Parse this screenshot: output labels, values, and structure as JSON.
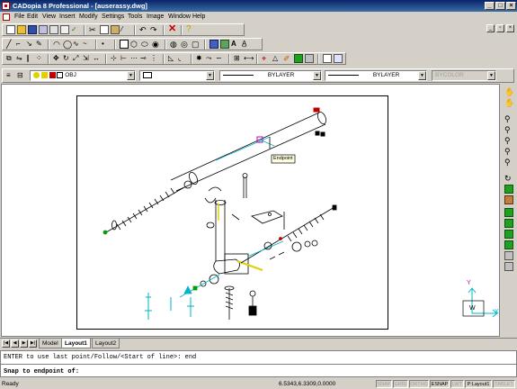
{
  "window": {
    "title": "CADopia 8 Professional - [auserassy.dwg]"
  },
  "menu": [
    "File",
    "Edit",
    "View",
    "Insert",
    "Modify",
    "Settings",
    "Tools",
    "Image",
    "Window",
    "Help"
  ],
  "toolbar_properties": {
    "layer_value": "OBJ",
    "color_value": "",
    "linetype_value": "BYLAYER",
    "lineweight_value": "BYLAYER",
    "plotstyle_value": "BYCOLOR"
  },
  "drawing": {
    "tooltip": "Endpoint",
    "ucs_x": "X",
    "ucs_y": "Y",
    "ucs_w": "W"
  },
  "tabs": {
    "model": "Model",
    "layout1": "Layout1",
    "layout2": "Layout2"
  },
  "command": {
    "history": "ENTER to use last point/Follow/<Start of line>: end",
    "prompt": "Snap to endpoint of:"
  },
  "status": {
    "ready": "Ready",
    "coords": "6.5343,6.3309,0.0000",
    "panes": [
      "SNAP",
      "GRID",
      "ORTHO",
      "ESNAP",
      "LWT",
      "P:Layout1",
      "TABLET"
    ]
  },
  "colors": {
    "title_start": "#0a246a",
    "title_end": "#3a6ea5",
    "chrome": "#d4d0c8",
    "cad_cyan": "#00b4c8",
    "cad_green": "#00a000",
    "cad_yellow": "#e0d000",
    "cad_magenta": "#c000c0"
  }
}
